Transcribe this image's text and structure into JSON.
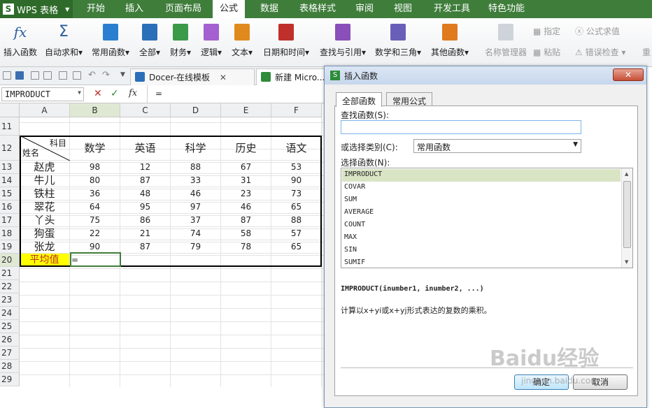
{
  "app": {
    "name": "WPS 表格",
    "logo": "S"
  },
  "menu_tabs": [
    {
      "label": "开始"
    },
    {
      "label": "插入"
    },
    {
      "label": "页面布局"
    },
    {
      "label": "公式"
    },
    {
      "label": "数据"
    },
    {
      "label": "表格样式"
    },
    {
      "label": "审阅"
    },
    {
      "label": "视图"
    },
    {
      "label": "开发工具"
    },
    {
      "label": "特色功能"
    }
  ],
  "ribbon": {
    "buttons": [
      {
        "label": "插入函数",
        "icon": "fx"
      },
      {
        "label": "自动求和▾",
        "icon": "Σ"
      },
      {
        "label": "常用函数▾",
        "icon": "common-functions-icon",
        "color": "#2b7fd0"
      },
      {
        "label": "全部▾",
        "icon": "all-functions-icon",
        "color": "#2b6fb8"
      },
      {
        "label": "财务▾",
        "icon": "finance-icon",
        "color": "#3a9a48"
      },
      {
        "label": "逻辑▾",
        "icon": "logic-icon",
        "color": "#8a4fb8"
      },
      {
        "label": "文本▾",
        "icon": "text-icon",
        "color": "#e08a1e"
      },
      {
        "label": "日期和时间▾",
        "icon": "datetime-icon",
        "color": "#c0302a"
      },
      {
        "label": "查找与引用▾",
        "icon": "lookup-icon",
        "color": "#8a4fb8"
      },
      {
        "label": "数学和三角▾",
        "icon": "math-icon",
        "color": "#6a5fb8"
      },
      {
        "label": "其他函数▾",
        "icon": "other-functions-icon",
        "color": "#e07a1e"
      }
    ],
    "right": {
      "name_manager": "名称管理器",
      "define": "指定",
      "paste": "粘贴",
      "evaluate": "公式求值",
      "error_check": "错误检查 ▾",
      "recalc": "重"
    }
  },
  "doc_tabs": [
    {
      "label": "Docer-在线模板",
      "close": "✕"
    },
    {
      "label": "新建 Micro...",
      "close": ""
    }
  ],
  "formula_bar": {
    "name_box": "IMPRODUCT",
    "cancel": "✕",
    "confirm": "✓",
    "fx": "fx",
    "content": "="
  },
  "sheet": {
    "columns": [
      "A",
      "B",
      "C",
      "D",
      "E",
      "F"
    ],
    "row_numbers": [
      "11",
      "12",
      "13",
      "14",
      "15",
      "16",
      "17",
      "18",
      "19",
      "20",
      "21",
      "22",
      "23",
      "24",
      "25",
      "26",
      "27",
      "28",
      "29"
    ],
    "header_corner": {
      "top": "科目",
      "bottom": "姓名"
    },
    "subjects": [
      "数学",
      "英语",
      "科学",
      "历史",
      "语文"
    ],
    "students": [
      {
        "name": "赵虎",
        "scores": [
          "98",
          "12",
          "88",
          "67",
          "53"
        ]
      },
      {
        "name": "牛儿",
        "scores": [
          "80",
          "87",
          "33",
          "31",
          "90"
        ]
      },
      {
        "name": "铁柱",
        "scores": [
          "36",
          "48",
          "46",
          "23",
          "73"
        ]
      },
      {
        "name": "翠花",
        "scores": [
          "64",
          "95",
          "97",
          "46",
          "65"
        ]
      },
      {
        "name": "丫头",
        "scores": [
          "75",
          "86",
          "37",
          "87",
          "88"
        ]
      },
      {
        "name": "狗蛋",
        "scores": [
          "22",
          "21",
          "74",
          "58",
          "57"
        ]
      },
      {
        "name": "张龙",
        "scores": [
          "90",
          "87",
          "79",
          "78",
          "65"
        ]
      }
    ],
    "average_label": "平均值",
    "active_cell_value": "="
  },
  "dialog": {
    "title": "插入函数",
    "close": "✕",
    "tabs": [
      "全部函数",
      "常用公式"
    ],
    "search_label": "查找函数(S):",
    "search_value": "",
    "category_label": "或选择类别(C):",
    "category_value": "常用函数",
    "list_label": "选择函数(N):",
    "functions": [
      "IMPRODUCT",
      "COVAR",
      "SUM",
      "AVERAGE",
      "COUNT",
      "MAX",
      "SIN",
      "SUMIF"
    ],
    "syntax": "IMPRODUCT(inumber1, inumber2, ...)",
    "description": "计算以x+yi或x+yj形式表达的复数的乘积。",
    "ok": "确定",
    "cancel": "取消"
  },
  "watermark": {
    "brand": "Baidu经验",
    "url": "jingyan.baidu.com"
  }
}
